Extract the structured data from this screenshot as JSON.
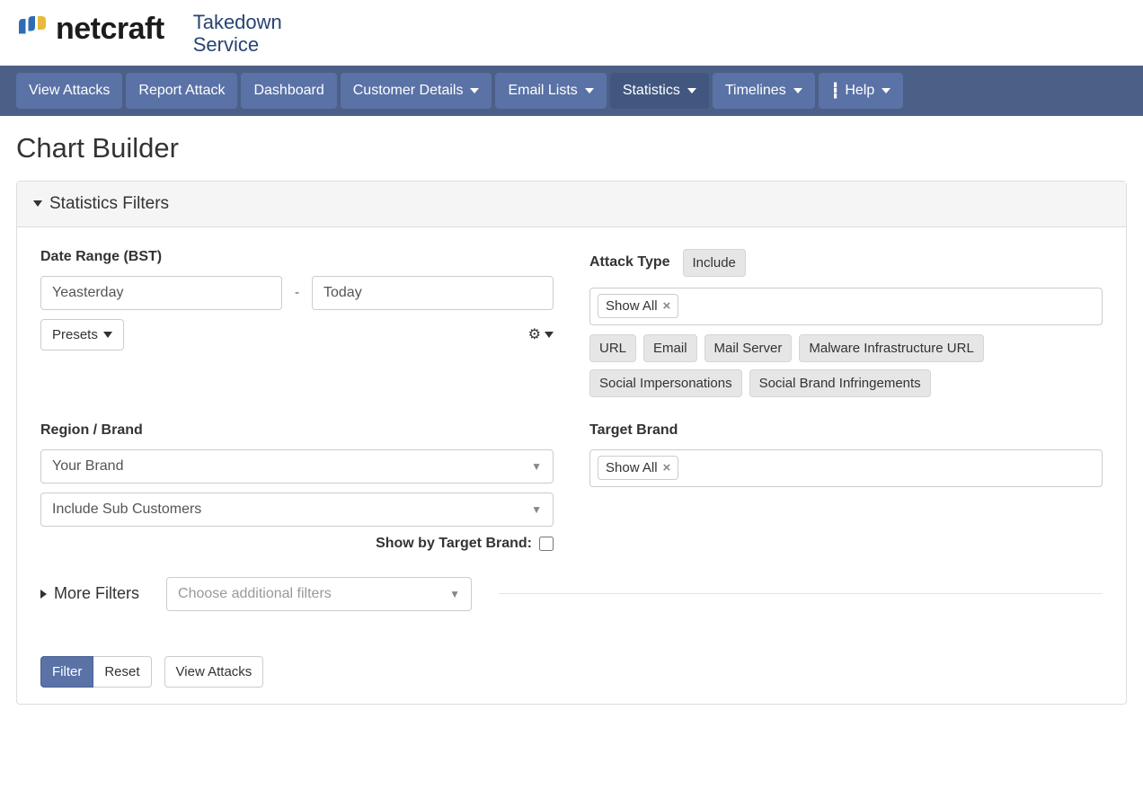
{
  "brand": {
    "word": "netcraft",
    "subtitle_line1": "Takedown",
    "subtitle_line2": "Service"
  },
  "nav": {
    "view_attacks": "View Attacks",
    "report_attack": "Report Attack",
    "dashboard": "Dashboard",
    "customer_details": "Customer Details",
    "email_lists": "Email Lists",
    "statistics": "Statistics",
    "timelines": "Timelines",
    "help": "Help"
  },
  "page": {
    "title": "Chart Builder"
  },
  "panel": {
    "title": "Statistics Filters"
  },
  "filters": {
    "date_range_label": "Date Range (BST)",
    "date_from": "Yeasterday",
    "date_to": "Today",
    "presets_btn": "Presets",
    "attack_type_label": "Attack Type",
    "attack_type_toggle": "Include",
    "attack_type_token": "Show All",
    "attack_type_chips": [
      "URL",
      "Email",
      "Mail Server",
      "Malware Infrastructure URL",
      "Social Impersonations",
      "Social Brand Infringements"
    ],
    "region_brand_label": "Region / Brand",
    "region_brand_value": "Your Brand",
    "include_sub_value": "Include Sub Customers",
    "show_by_target_label": "Show by Target Brand:",
    "target_brand_label": "Target Brand",
    "target_brand_token": "Show All",
    "more_filters_label": "More Filters",
    "more_filters_placeholder": "Choose additional filters"
  },
  "buttons": {
    "filter": "Filter",
    "reset": "Reset",
    "view_attacks": "View Attacks"
  }
}
